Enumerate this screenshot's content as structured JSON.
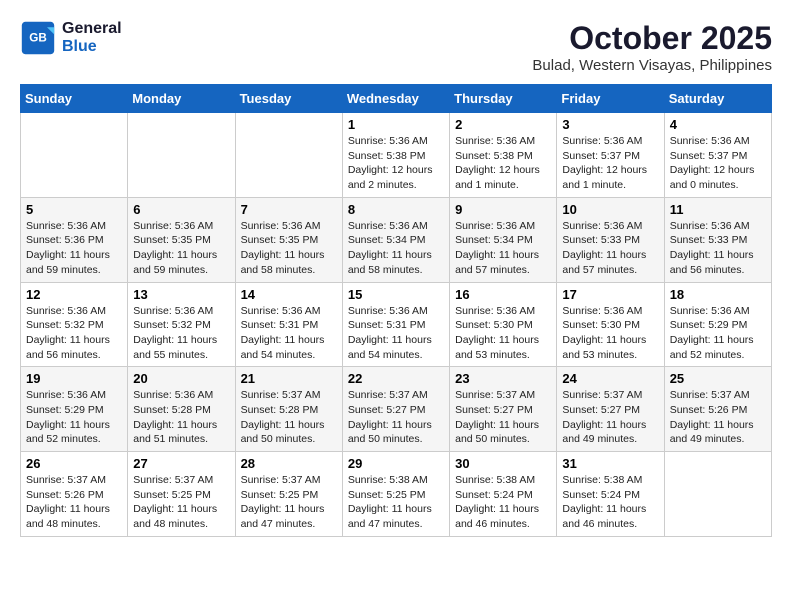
{
  "logo": {
    "line1": "General",
    "line2": "Blue"
  },
  "title": "October 2025",
  "location": "Bulad, Western Visayas, Philippines",
  "weekdays": [
    "Sunday",
    "Monday",
    "Tuesday",
    "Wednesday",
    "Thursday",
    "Friday",
    "Saturday"
  ],
  "weeks": [
    [
      {
        "day": "",
        "info": ""
      },
      {
        "day": "",
        "info": ""
      },
      {
        "day": "",
        "info": ""
      },
      {
        "day": "1",
        "sunrise": "Sunrise: 5:36 AM",
        "sunset": "Sunset: 5:38 PM",
        "daylight": "Daylight: 12 hours and 2 minutes."
      },
      {
        "day": "2",
        "sunrise": "Sunrise: 5:36 AM",
        "sunset": "Sunset: 5:38 PM",
        "daylight": "Daylight: 12 hours and 1 minute."
      },
      {
        "day": "3",
        "sunrise": "Sunrise: 5:36 AM",
        "sunset": "Sunset: 5:37 PM",
        "daylight": "Daylight: 12 hours and 1 minute."
      },
      {
        "day": "4",
        "sunrise": "Sunrise: 5:36 AM",
        "sunset": "Sunset: 5:37 PM",
        "daylight": "Daylight: 12 hours and 0 minutes."
      }
    ],
    [
      {
        "day": "5",
        "sunrise": "Sunrise: 5:36 AM",
        "sunset": "Sunset: 5:36 PM",
        "daylight": "Daylight: 11 hours and 59 minutes."
      },
      {
        "day": "6",
        "sunrise": "Sunrise: 5:36 AM",
        "sunset": "Sunset: 5:35 PM",
        "daylight": "Daylight: 11 hours and 59 minutes."
      },
      {
        "day": "7",
        "sunrise": "Sunrise: 5:36 AM",
        "sunset": "Sunset: 5:35 PM",
        "daylight": "Daylight: 11 hours and 58 minutes."
      },
      {
        "day": "8",
        "sunrise": "Sunrise: 5:36 AM",
        "sunset": "Sunset: 5:34 PM",
        "daylight": "Daylight: 11 hours and 58 minutes."
      },
      {
        "day": "9",
        "sunrise": "Sunrise: 5:36 AM",
        "sunset": "Sunset: 5:34 PM",
        "daylight": "Daylight: 11 hours and 57 minutes."
      },
      {
        "day": "10",
        "sunrise": "Sunrise: 5:36 AM",
        "sunset": "Sunset: 5:33 PM",
        "daylight": "Daylight: 11 hours and 57 minutes."
      },
      {
        "day": "11",
        "sunrise": "Sunrise: 5:36 AM",
        "sunset": "Sunset: 5:33 PM",
        "daylight": "Daylight: 11 hours and 56 minutes."
      }
    ],
    [
      {
        "day": "12",
        "sunrise": "Sunrise: 5:36 AM",
        "sunset": "Sunset: 5:32 PM",
        "daylight": "Daylight: 11 hours and 56 minutes."
      },
      {
        "day": "13",
        "sunrise": "Sunrise: 5:36 AM",
        "sunset": "Sunset: 5:32 PM",
        "daylight": "Daylight: 11 hours and 55 minutes."
      },
      {
        "day": "14",
        "sunrise": "Sunrise: 5:36 AM",
        "sunset": "Sunset: 5:31 PM",
        "daylight": "Daylight: 11 hours and 54 minutes."
      },
      {
        "day": "15",
        "sunrise": "Sunrise: 5:36 AM",
        "sunset": "Sunset: 5:31 PM",
        "daylight": "Daylight: 11 hours and 54 minutes."
      },
      {
        "day": "16",
        "sunrise": "Sunrise: 5:36 AM",
        "sunset": "Sunset: 5:30 PM",
        "daylight": "Daylight: 11 hours and 53 minutes."
      },
      {
        "day": "17",
        "sunrise": "Sunrise: 5:36 AM",
        "sunset": "Sunset: 5:30 PM",
        "daylight": "Daylight: 11 hours and 53 minutes."
      },
      {
        "day": "18",
        "sunrise": "Sunrise: 5:36 AM",
        "sunset": "Sunset: 5:29 PM",
        "daylight": "Daylight: 11 hours and 52 minutes."
      }
    ],
    [
      {
        "day": "19",
        "sunrise": "Sunrise: 5:36 AM",
        "sunset": "Sunset: 5:29 PM",
        "daylight": "Daylight: 11 hours and 52 minutes."
      },
      {
        "day": "20",
        "sunrise": "Sunrise: 5:36 AM",
        "sunset": "Sunset: 5:28 PM",
        "daylight": "Daylight: 11 hours and 51 minutes."
      },
      {
        "day": "21",
        "sunrise": "Sunrise: 5:37 AM",
        "sunset": "Sunset: 5:28 PM",
        "daylight": "Daylight: 11 hours and 50 minutes."
      },
      {
        "day": "22",
        "sunrise": "Sunrise: 5:37 AM",
        "sunset": "Sunset: 5:27 PM",
        "daylight": "Daylight: 11 hours and 50 minutes."
      },
      {
        "day": "23",
        "sunrise": "Sunrise: 5:37 AM",
        "sunset": "Sunset: 5:27 PM",
        "daylight": "Daylight: 11 hours and 50 minutes."
      },
      {
        "day": "24",
        "sunrise": "Sunrise: 5:37 AM",
        "sunset": "Sunset: 5:27 PM",
        "daylight": "Daylight: 11 hours and 49 minutes."
      },
      {
        "day": "25",
        "sunrise": "Sunrise: 5:37 AM",
        "sunset": "Sunset: 5:26 PM",
        "daylight": "Daylight: 11 hours and 49 minutes."
      }
    ],
    [
      {
        "day": "26",
        "sunrise": "Sunrise: 5:37 AM",
        "sunset": "Sunset: 5:26 PM",
        "daylight": "Daylight: 11 hours and 48 minutes."
      },
      {
        "day": "27",
        "sunrise": "Sunrise: 5:37 AM",
        "sunset": "Sunset: 5:25 PM",
        "daylight": "Daylight: 11 hours and 48 minutes."
      },
      {
        "day": "28",
        "sunrise": "Sunrise: 5:37 AM",
        "sunset": "Sunset: 5:25 PM",
        "daylight": "Daylight: 11 hours and 47 minutes."
      },
      {
        "day": "29",
        "sunrise": "Sunrise: 5:38 AM",
        "sunset": "Sunset: 5:25 PM",
        "daylight": "Daylight: 11 hours and 47 minutes."
      },
      {
        "day": "30",
        "sunrise": "Sunrise: 5:38 AM",
        "sunset": "Sunset: 5:24 PM",
        "daylight": "Daylight: 11 hours and 46 minutes."
      },
      {
        "day": "31",
        "sunrise": "Sunrise: 5:38 AM",
        "sunset": "Sunset: 5:24 PM",
        "daylight": "Daylight: 11 hours and 46 minutes."
      },
      {
        "day": "",
        "info": ""
      }
    ]
  ]
}
